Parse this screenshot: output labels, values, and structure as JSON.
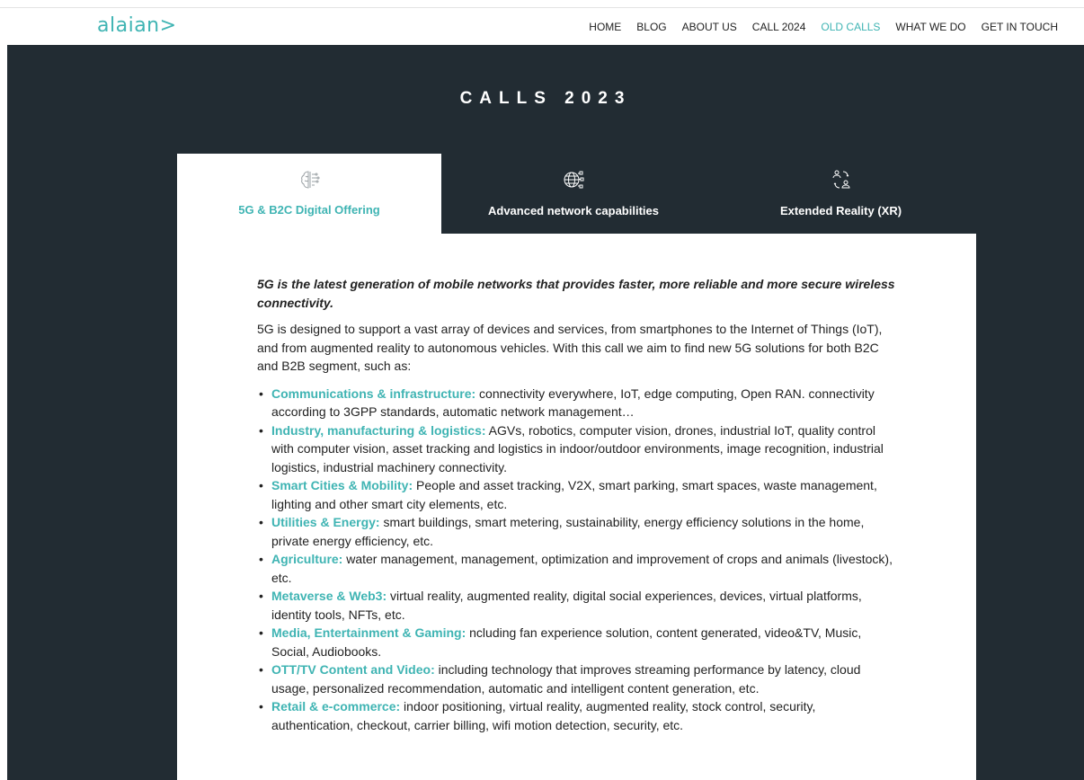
{
  "brand": {
    "logo_text": "alaian>",
    "accent": "#3fb4b3"
  },
  "nav": {
    "items": [
      {
        "label": "HOME"
      },
      {
        "label": "BLOG"
      },
      {
        "label": "ABOUT US"
      },
      {
        "label": "CALL 2024"
      },
      {
        "label": "OLD CALLS",
        "active": true
      },
      {
        "label": "WHAT WE DO"
      },
      {
        "label": "GET IN TOUCH"
      }
    ]
  },
  "hero": {
    "title": "CALLS 2023",
    "background": "#222c33"
  },
  "tabs": [
    {
      "label": "5G & B2C Digital Offering",
      "icon": "brain-circuit-icon",
      "active": true
    },
    {
      "label": "Advanced network capabilities",
      "icon": "globe-network-icon",
      "active": false
    },
    {
      "label": "Extended Reality (XR)",
      "icon": "people-exchange-icon",
      "active": false
    }
  ],
  "content": {
    "lead": "5G is the latest generation of mobile networks that provides faster, more reliable and more secure wireless connectivity.",
    "intro": "5G is designed to support a vast array of devices and services, from smartphones to the Internet of Things (IoT), and from augmented reality to autonomous vehicles. With this call we aim to find new 5G solutions for both B2C and B2B segment, such as:",
    "items": [
      {
        "title": "Communications & infrastructure:",
        "text": " connectivity everywhere, IoT, edge computing, Open RAN. connectivity according to 3GPP standards, automatic network management…"
      },
      {
        "title": "Industry, manufacturing & logistics:",
        "text": " AGVs, robotics, computer vision, drones, industrial IoT, quality control with computer vision, asset tracking and logistics in indoor/outdoor environments, image recognition, industrial logistics, industrial machinery connectivity."
      },
      {
        "title": "Smart Cities & Mobility:",
        "text": " People and asset tracking, V2X, smart parking, smart spaces, waste management, lighting and other smart city elements, etc."
      },
      {
        "title": "Utilities & Energy:",
        "text": " smart buildings, smart metering, sustainability, energy efficiency solutions in the home, private energy efficiency, etc."
      },
      {
        "title": "Agriculture:",
        "text": " water management, management, optimization and improvement of crops and animals (livestock), etc."
      },
      {
        "title": "Metaverse & Web3:",
        "text": " virtual reality, augmented reality, digital social experiences, devices, virtual platforms, identity tools, NFTs, etc."
      },
      {
        "title": "Media, Entertainment & Gaming:",
        "text": " ncluding fan experience solution, content generated, video&TV, Music, Social, Audiobooks."
      },
      {
        "title": "OTT/TV Content and Video:",
        "text": " including technology that improves streaming performance by latency, cloud usage, personalized recommendation, automatic and intelligent content generation, etc."
      },
      {
        "title": "Retail & e-commerce:",
        "text": " indoor positioning, virtual reality, augmented reality, stock control, security, authentication, checkout, carrier billing, wifi motion detection, security, etc."
      }
    ]
  }
}
